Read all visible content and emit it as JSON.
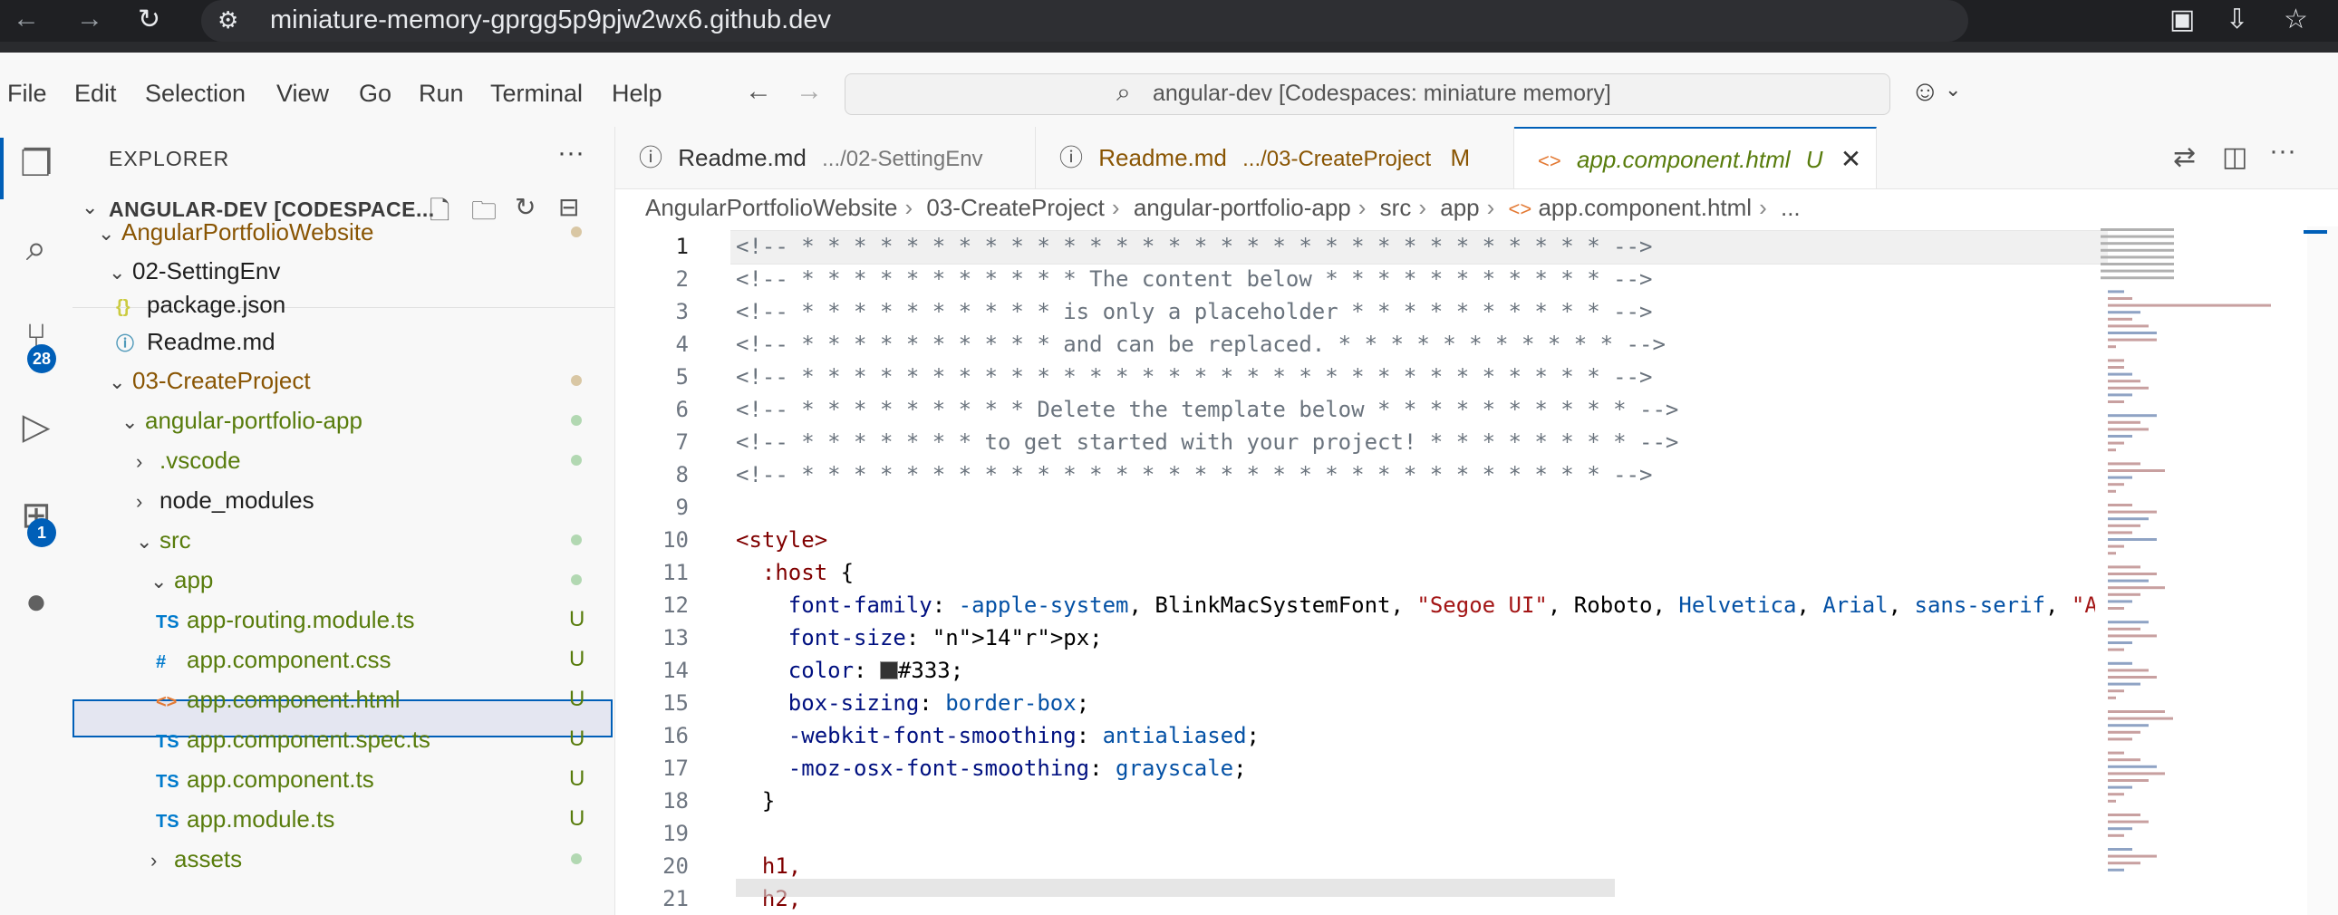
{
  "browser": {
    "url": "miniature-memory-gprgg5p9pjw2wx6.github.dev"
  },
  "menu": {
    "items": [
      "File",
      "Edit",
      "Selection",
      "View",
      "Go",
      "Run",
      "Terminal",
      "Help"
    ]
  },
  "command_center": {
    "text": "angular-dev [Codespaces: miniature memory]"
  },
  "activity": {
    "source_control_badge": "28",
    "extensions_badge": "1"
  },
  "explorer": {
    "title": "EXPLORER",
    "more": "···",
    "project": "ANGULAR-DEV [CODESPACE...",
    "tree": [
      {
        "label": "AngularPortfolioWebsite",
        "chev": "⌄",
        "icon": "",
        "status": "dot"
      },
      {
        "label": "02-SettingEnv",
        "chev": "⌄",
        "icon": "",
        "status": ""
      },
      {
        "label": "package.json",
        "chev": "",
        "icon": "{}",
        "status": ""
      },
      {
        "label": "Readme.md",
        "chev": "",
        "icon": "ⓘ",
        "status": ""
      },
      {
        "label": "03-CreateProject",
        "chev": "⌄",
        "icon": "",
        "status": "dot"
      },
      {
        "label": "angular-portfolio-app",
        "chev": "⌄",
        "icon": "",
        "status": "dot"
      },
      {
        "label": ".vscode",
        "chev": "›",
        "icon": "",
        "status": "dot"
      },
      {
        "label": "node_modules",
        "chev": "›",
        "icon": "",
        "status": ""
      },
      {
        "label": "src",
        "chev": "⌄",
        "icon": "",
        "status": "dot"
      },
      {
        "label": "app",
        "chev": "⌄",
        "icon": "",
        "status": "dot"
      },
      {
        "label": "app-routing.module.ts",
        "chev": "",
        "icon": "TS",
        "status": "U"
      },
      {
        "label": "app.component.css",
        "chev": "",
        "icon": "#",
        "status": "U"
      },
      {
        "label": "app.component.html",
        "chev": "",
        "icon": "<>",
        "status": "U"
      },
      {
        "label": "app.component.spec.ts",
        "chev": "",
        "icon": "TS",
        "status": "U"
      },
      {
        "label": "app.component.ts",
        "chev": "",
        "icon": "TS",
        "status": "U"
      },
      {
        "label": "app.module.ts",
        "chev": "",
        "icon": "TS",
        "status": "U"
      },
      {
        "label": "assets",
        "chev": "›",
        "icon": "",
        "status": "dot"
      }
    ]
  },
  "tabs": [
    {
      "icon": "ⓘ",
      "name": "Readme.md",
      "path": ".../02-SettingEnv",
      "status": ""
    },
    {
      "icon": "ⓘ",
      "name": "Readme.md",
      "path": ".../03-CreateProject",
      "status": "M"
    },
    {
      "icon": "<>",
      "name": "app.component.html",
      "path": "",
      "status": "U"
    }
  ],
  "breadcrumbs": [
    "AngularPortfolioWebsite",
    "03-CreateProject",
    "angular-portfolio-app",
    "src",
    "app",
    "app.component.html",
    "..."
  ],
  "editor": {
    "line_numbers": [
      "1",
      "2",
      "3",
      "4",
      "5",
      "6",
      "7",
      "8",
      "9",
      "10",
      "11",
      "12",
      "13",
      "14",
      "15",
      "16",
      "17",
      "18",
      "19",
      "20",
      "21"
    ],
    "lines": [
      "<!-- * * * * * * * * * * * * * * * * * * * * * * * * * * * * * * * -->",
      "<!-- * * * * * * * * * * * The content below * * * * * * * * * * * -->",
      "<!-- * * * * * * * * * * is only a placeholder * * * * * * * * * * -->",
      "<!-- * * * * * * * * * * and can be replaced. * * * * * * * * * * * -->",
      "<!-- * * * * * * * * * * * * * * * * * * * * * * * * * * * * * * * -->",
      "<!-- * * * * * * * * * Delete the template below * * * * * * * * * * -->",
      "<!-- * * * * * * * to get started with your project! * * * * * * * * -->",
      "<!-- * * * * * * * * * * * * * * * * * * * * * * * * * * * * * * * -->",
      "",
      "<style>",
      "  :host {",
      "    font-family: -apple-system, BlinkMacSystemFont, \"Segoe UI\", Roboto, Helvetica, Arial, sans-serif, \"A",
      "    font-size: 14px;",
      "    color: ■#333;",
      "    box-sizing: border-box;",
      "    -webkit-font-smoothing: antialiased;",
      "    -moz-osx-font-smoothing: grayscale;",
      "  }",
      "",
      "  h1,",
      "  h2,"
    ]
  },
  "colors": {
    "accent": "#005fb8",
    "modified": "#895503",
    "untracked": "#587c0c",
    "added_dot": "#b2d8b2"
  }
}
